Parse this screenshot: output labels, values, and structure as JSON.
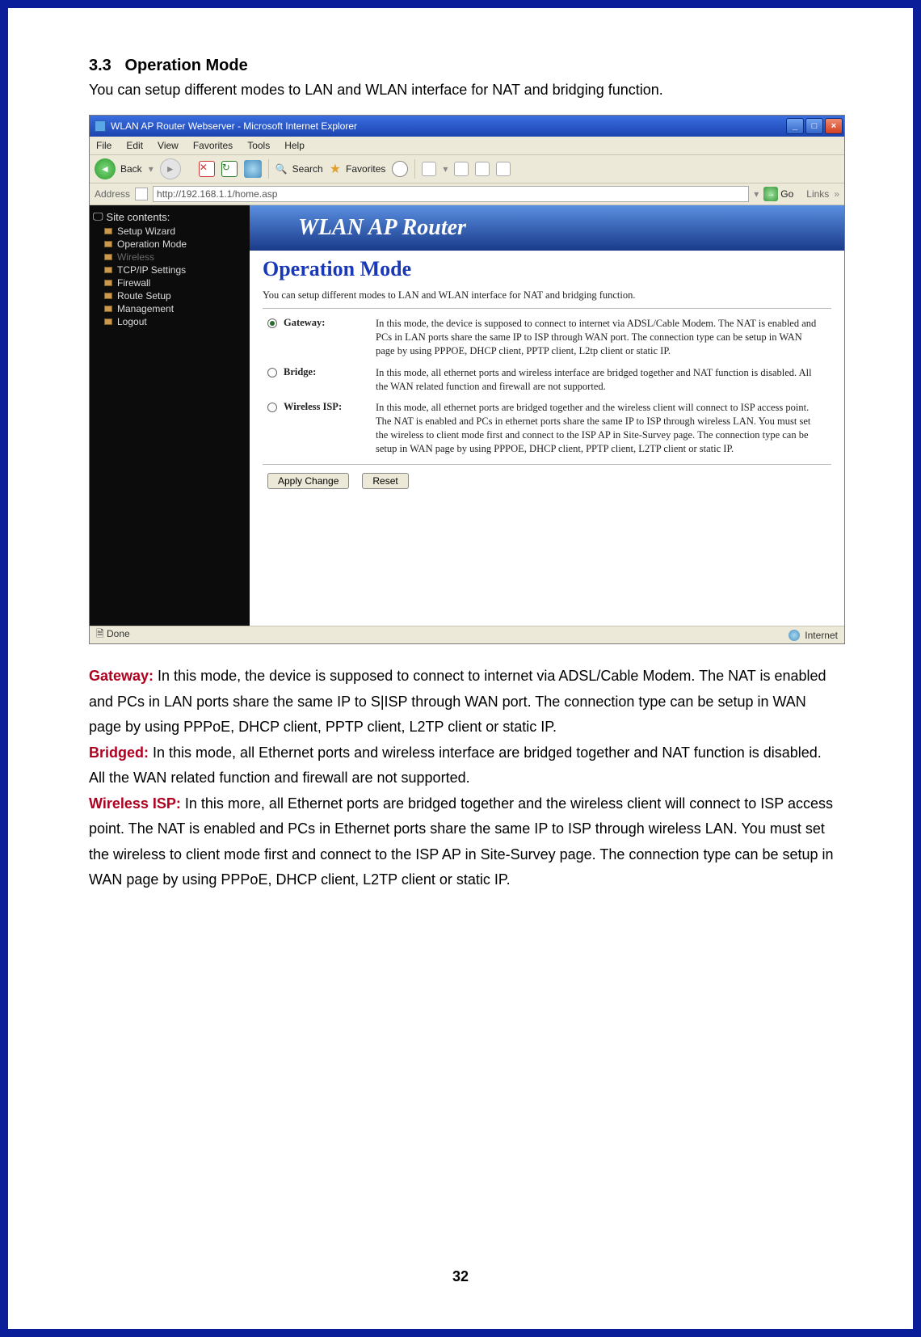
{
  "section": {
    "number": "3.3",
    "title": "Operation Mode",
    "intro": "You can setup different modes to LAN and WLAN interface for NAT and bridging function."
  },
  "ie": {
    "title": "WLAN AP Router Webserver - Microsoft Internet Explorer",
    "menu": {
      "file": "File",
      "edit": "Edit",
      "view": "View",
      "favorites": "Favorites",
      "tools": "Tools",
      "help": "Help"
    },
    "toolbar": {
      "back": "Back",
      "search": "Search",
      "favorites": "Favorites"
    },
    "address": {
      "label": "Address",
      "value": "http://192.168.1.1/home.asp",
      "go": "Go",
      "links": "Links"
    },
    "status": {
      "done": "Done",
      "zone": "Internet"
    }
  },
  "sidebar": {
    "heading": "Site contents:",
    "items": [
      {
        "label": "Setup Wizard",
        "dim": false
      },
      {
        "label": "Operation Mode",
        "dim": false
      },
      {
        "label": "Wireless",
        "dim": true
      },
      {
        "label": "TCP/IP Settings",
        "dim": false
      },
      {
        "label": "Firewall",
        "dim": false
      },
      {
        "label": "Route Setup",
        "dim": false
      },
      {
        "label": "Management",
        "dim": false
      },
      {
        "label": "Logout",
        "dim": false
      }
    ]
  },
  "page": {
    "banner": "WLAN AP Router",
    "heading": "Operation Mode",
    "subtext": "You can setup different modes to LAN and WLAN interface for NAT and bridging function.",
    "modes": [
      {
        "label": "Gateway:",
        "selected": true,
        "desc": "In this mode, the device is supposed to connect to internet via ADSL/Cable Modem. The NAT is enabled and PCs in LAN ports share the same IP to ISP through WAN port. The connection type can be setup in WAN page by using PPPOE, DHCP client, PPTP client, L2tp client or static IP."
      },
      {
        "label": "Bridge:",
        "selected": false,
        "desc": "In this mode, all ethernet ports and wireless interface are bridged together and NAT function is disabled. All the WAN related function and firewall are not supported."
      },
      {
        "label": "Wireless ISP:",
        "selected": false,
        "desc": "In this mode, all ethernet ports are bridged together and the wireless client will connect to ISP access point. The NAT is enabled and PCs in ethernet ports share the same IP to ISP through wireless LAN. You must set the wireless to client mode first and connect to the ISP AP in Site-Survey page. The connection type can be setup in WAN page by using PPPOE, DHCP client, PPTP client, L2TP client or static IP."
      }
    ],
    "buttons": {
      "apply": "Apply Change",
      "reset": "Reset"
    }
  },
  "body_text": {
    "gateway_label": "Gateway:",
    "gateway_text": " In this mode, the device is supposed to connect to internet via ADSL/Cable Modem. The NAT is enabled and PCs in LAN ports share the same IP to S|ISP through WAN port. The connection type can be setup in WAN page by using PPPoE, DHCP client, PPTP client, L2TP client or static IP.",
    "bridged_label": "Bridged:",
    "bridged_text": " In this mode, all Ethernet ports and wireless interface are bridged together and NAT function is disabled. All the WAN related function and firewall are not supported.",
    "wisp_label": "Wireless ISP:",
    "wisp_text": " In this more, all Ethernet ports are bridged together and the wireless client will connect to ISP access point. The NAT is enabled and PCs in Ethernet ports share the same IP to ISP through wireless LAN. You must set the wireless to client mode first and connect to the ISP AP in Site-Survey page. The connection type can be setup in WAN page by using PPPoE, DHCP client, L2TP client or static IP."
  },
  "page_number": "32"
}
